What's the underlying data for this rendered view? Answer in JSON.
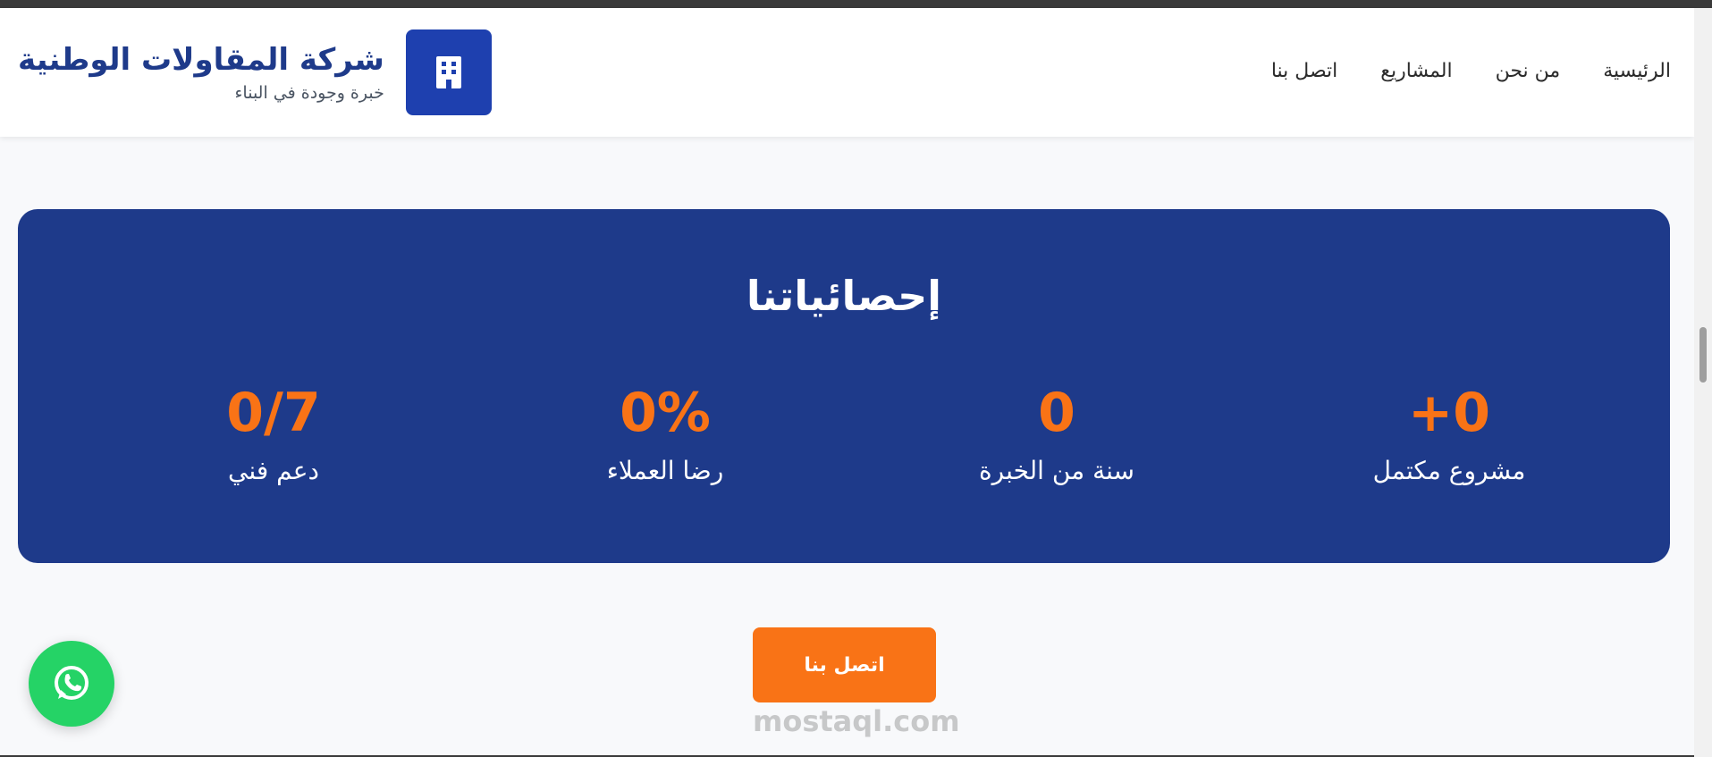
{
  "header": {
    "brand_title": "شركة المقاولات الوطنية",
    "brand_tagline": "خبرة وجودة في البناء",
    "logo_icon": "building-icon",
    "nav": [
      {
        "label": "الرئيسية"
      },
      {
        "label": "من نحن"
      },
      {
        "label": "المشاريع"
      },
      {
        "label": "اتصل بنا"
      }
    ]
  },
  "stats": {
    "title": "إحصائياتنا",
    "items": [
      {
        "value": "+0",
        "label": "مشروع مكتمل"
      },
      {
        "value": "0",
        "label": "سنة من الخبرة"
      },
      {
        "value": "0%",
        "label": "رضا العملاء"
      },
      {
        "value": "0/7",
        "label": "دعم فني"
      }
    ]
  },
  "cta": {
    "label": "اتصل بنا"
  },
  "watermark": {
    "text": "mostaql.com"
  },
  "colors": {
    "primary": "#1e3a8a",
    "accent": "#f97316",
    "whatsapp": "#25d366"
  },
  "floating": {
    "icon": "whatsapp-icon"
  }
}
